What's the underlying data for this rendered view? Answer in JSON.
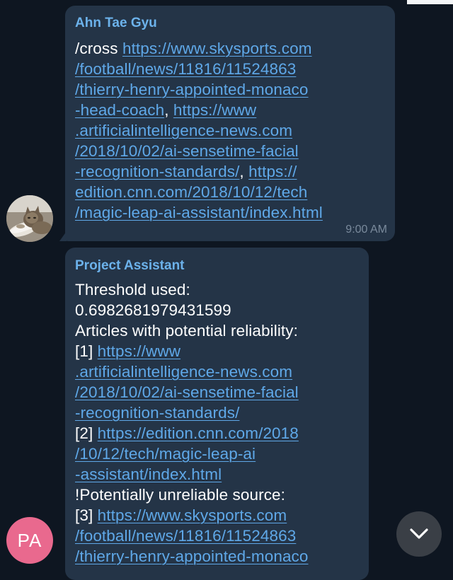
{
  "messages": [
    {
      "sender": "Ahn Tae Gyu",
      "time": "9:00 AM",
      "lines": [
        [
          {
            "t": "/cross "
          },
          {
            "t": "https://www.skysports.com",
            "link": true
          }
        ],
        [
          {
            "t": "/football/news/11816/11524863",
            "link": true
          }
        ],
        [
          {
            "t": "/thierry-henry-appointed-monaco",
            "link": true
          }
        ],
        [
          {
            "t": "-head-coach",
            "link": true
          },
          {
            "t": ", "
          },
          {
            "t": "https://www",
            "link": true
          }
        ],
        [
          {
            "t": ".artificialintelligence-news.com",
            "link": true
          }
        ],
        [
          {
            "t": "/2018/10/02/ai-sensetime-facial",
            "link": true
          }
        ],
        [
          {
            "t": "-recognition-standards/",
            "link": true
          },
          {
            "t": ", "
          },
          {
            "t": "https://",
            "link": true
          }
        ],
        [
          {
            "t": "edition.cnn.com/2018/10/12/tech",
            "link": true
          }
        ],
        [
          {
            "t": "/magic-leap-ai-assistant/index.html",
            "link": true
          }
        ]
      ]
    },
    {
      "sender": "Project Assistant",
      "lines": [
        [
          {
            "t": "Threshold used:"
          }
        ],
        [
          {
            "t": "0.6982681979431599"
          }
        ],
        [
          {
            "t": "Articles with potential reliability:"
          }
        ],
        [
          {
            "t": "[1] "
          },
          {
            "t": "https://www",
            "link": true
          }
        ],
        [
          {
            "t": ".artificialintelligence-news.com",
            "link": true
          }
        ],
        [
          {
            "t": "/2018/10/02/ai-sensetime-facial",
            "link": true
          }
        ],
        [
          {
            "t": "-recognition-standards/",
            "link": true
          }
        ],
        [
          {
            "t": "[2] "
          },
          {
            "t": "https://edition.cnn.com/2018",
            "link": true
          }
        ],
        [
          {
            "t": "/10/12/tech/magic-leap-ai",
            "link": true
          }
        ],
        [
          {
            "t": "-assistant/index.html",
            "link": true
          }
        ],
        [
          {
            "t": "!Potentially unreliable source:"
          }
        ],
        [
          {
            "t": "[3] "
          },
          {
            "t": "https://www.skysports.com",
            "link": true
          }
        ],
        [
          {
            "t": "/football/news/11816/11524863",
            "link": true
          }
        ],
        [
          {
            "t": "/thierry-henry-appointed-monaco",
            "link": true
          }
        ]
      ]
    }
  ],
  "avatars": {
    "project_assistant_initials": "PA"
  },
  "scroll_button": {
    "icon": "chevron-down-icon"
  },
  "colors": {
    "background": "#0e1621",
    "bubble": "#243447",
    "sender_name": "#6cb2eb",
    "link": "#5fa8e8",
    "time": "#7a8a9c",
    "avatar_pa": "#e9698e",
    "scroll_button": "#3a3f46"
  }
}
